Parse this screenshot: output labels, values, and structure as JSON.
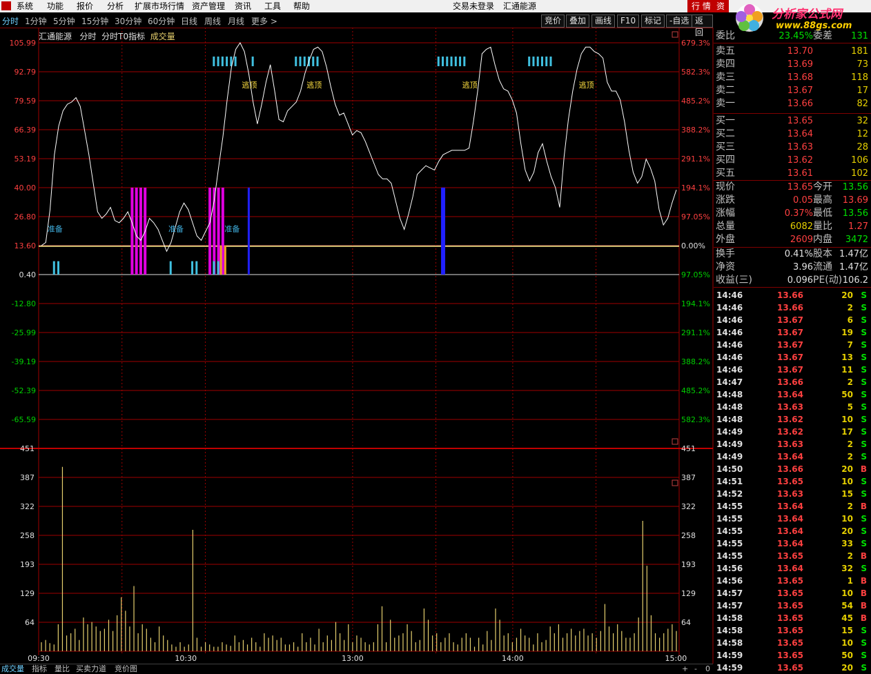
{
  "menubar": {
    "items": [
      "系统",
      "功能",
      "报价",
      "分析",
      "扩展市场行情",
      "资产管理",
      "资讯",
      "工具",
      "帮助"
    ],
    "status": "交易未登录",
    "stock_name": "汇通能源",
    "right_tabs": [
      "行 情",
      "资"
    ]
  },
  "watermark": {
    "title": "分析家公式网",
    "url": "www.88gs.com"
  },
  "periods": {
    "items": [
      "分时",
      "1分钟",
      "5分钟",
      "15分钟",
      "30分钟",
      "60分钟",
      "日线",
      "周线",
      "月线",
      "更多 >"
    ],
    "active": 0
  },
  "toolbar": [
    "竞价",
    "叠加",
    "画线",
    "F10",
    "标记",
    "-自选",
    "返回"
  ],
  "chart_header": {
    "name": "汇通能源",
    "mode": "分时",
    "indicator": "分时T0指标",
    "volume_label": "成交量"
  },
  "chart_data": [
    {
      "type": "line",
      "title": "分时T0指标",
      "ylim": [
        -72.0,
        112.0
      ],
      "y_tick_labels_left": [
        "105.99",
        "92.79",
        "79.59",
        "66.39",
        "53.19",
        "40.00",
        "26.80",
        "13.60",
        "0.40",
        "-12.80",
        "-25.99",
        "-39.19",
        "-52.39",
        "-65.59"
      ],
      "y_tick_labels_right": [
        "679.3%",
        "582.3%",
        "485.2%",
        "388.2%",
        "291.1%",
        "194.1%",
        "97.05%",
        "0.00%",
        "97.05%",
        "194.1%",
        "291.1%",
        "388.2%",
        "485.2%",
        "582.3%"
      ],
      "x_tick_labels": [
        "09:30",
        "10:30",
        "13:00",
        "14:00",
        "15:00"
      ],
      "series": [
        {
          "values": [
            13.6,
            15,
            30,
            55,
            68,
            75,
            78,
            79,
            81,
            77,
            66,
            55,
            42,
            29,
            26,
            28,
            31,
            25,
            24,
            26,
            29,
            24,
            18,
            16,
            20,
            26,
            24,
            21,
            16,
            11,
            15,
            22,
            29,
            33,
            30,
            24,
            18,
            16,
            20,
            24,
            34,
            49,
            63,
            80,
            95,
            103,
            106,
            102,
            92,
            79,
            69,
            78,
            88,
            96,
            84,
            71,
            70,
            75,
            77,
            79,
            84,
            92,
            98,
            103,
            104,
            102,
            95,
            86,
            78,
            73,
            74,
            69,
            64,
            66,
            65,
            61,
            56,
            51,
            46,
            44,
            44,
            42,
            34,
            26,
            21,
            28,
            36,
            46,
            48,
            50,
            49,
            48,
            52,
            55,
            56,
            57,
            57,
            57,
            57,
            58,
            70,
            84,
            101,
            103,
            104,
            96,
            89,
            85,
            84,
            80,
            74,
            60,
            48,
            43,
            47,
            56,
            60,
            52,
            45,
            40,
            31,
            54,
            71,
            84,
            94,
            101,
            104,
            104,
            102,
            101,
            99,
            88,
            84,
            84,
            80,
            70,
            57,
            47,
            42,
            45,
            53,
            49,
            43,
            30,
            23,
            26,
            33,
            39
          ]
        }
      ],
      "annotations": [
        {
          "text": "准备",
          "x_index": 3
        },
        {
          "text": "准备",
          "x_index": 31
        },
        {
          "text": "准备",
          "x_index": 44
        },
        {
          "text": "逃顶",
          "x_index": 48
        },
        {
          "text": "逃顶",
          "x_index": 63
        },
        {
          "text": "逃顶",
          "x_index": 99
        },
        {
          "text": "逃顶",
          "x_index": 126
        }
      ],
      "magenta_bars": [
        21,
        22,
        23,
        24,
        39,
        40,
        41,
        42
      ],
      "blue_bars": [
        48,
        93
      ],
      "top_markers": [
        40,
        41,
        42,
        43,
        44,
        45,
        49,
        59,
        60,
        61,
        62,
        63,
        64,
        92,
        93,
        94,
        95,
        96,
        97,
        98,
        113,
        114,
        115,
        116,
        117,
        118
      ]
    },
    {
      "type": "bar",
      "title": "成交量",
      "ylim": [
        0,
        470
      ],
      "y_tick_labels": [
        "451",
        "387",
        "322",
        "258",
        "193",
        "129",
        "64"
      ],
      "x_tick_labels": [
        "09:30",
        "10:30",
        "13:00",
        "14:00",
        "15:00"
      ],
      "values": [
        20,
        25,
        18,
        15,
        60,
        410,
        35,
        40,
        50,
        25,
        75,
        60,
        65,
        55,
        45,
        50,
        70,
        45,
        80,
        120,
        90,
        55,
        145,
        40,
        60,
        50,
        30,
        20,
        55,
        35,
        25,
        15,
        10,
        20,
        10,
        15,
        270,
        30,
        10,
        20,
        15,
        10,
        10,
        20,
        15,
        12,
        35,
        20,
        25,
        15,
        30,
        20,
        10,
        40,
        30,
        35,
        25,
        30,
        15,
        15,
        20,
        10,
        40,
        20,
        30,
        15,
        50,
        20,
        35,
        25,
        65,
        40,
        25,
        60,
        20,
        35,
        30,
        20,
        15,
        20,
        60,
        100,
        20,
        70,
        30,
        35,
        40,
        60,
        45,
        20,
        25,
        95,
        70,
        35,
        40,
        20,
        30,
        40,
        20,
        15,
        30,
        40,
        30,
        10,
        30,
        15,
        45,
        25,
        95,
        70,
        35,
        40,
        20,
        30,
        50,
        35,
        30,
        15,
        40,
        20,
        25,
        55,
        40,
        60,
        30,
        40,
        50,
        35,
        45,
        50,
        35,
        40,
        30,
        45,
        105,
        55,
        40,
        60,
        45,
        30,
        30,
        40,
        75,
        290,
        190,
        80,
        40,
        30,
        40,
        50,
        60,
        45
      ]
    }
  ],
  "quote": {
    "weibi": {
      "label": "委比",
      "value": "23.45%",
      "label2": "委差",
      "value2": "131"
    },
    "asks": [
      {
        "label": "卖五",
        "price": "13.70",
        "vol": "181"
      },
      {
        "label": "卖四",
        "price": "13.69",
        "vol": "73"
      },
      {
        "label": "卖三",
        "price": "13.68",
        "vol": "118"
      },
      {
        "label": "卖二",
        "price": "13.67",
        "vol": "17"
      },
      {
        "label": "卖一",
        "price": "13.66",
        "vol": "82"
      }
    ],
    "bids": [
      {
        "label": "买一",
        "price": "13.65",
        "vol": "32"
      },
      {
        "label": "买二",
        "price": "13.64",
        "vol": "12"
      },
      {
        "label": "买三",
        "price": "13.63",
        "vol": "28"
      },
      {
        "label": "买四",
        "price": "13.62",
        "vol": "106"
      },
      {
        "label": "买五",
        "price": "13.61",
        "vol": "102"
      }
    ],
    "stats": [
      {
        "l1": "现价",
        "v1": "13.65",
        "c1": "red",
        "l2": "今开",
        "v2": "13.56",
        "c2": "green"
      },
      {
        "l1": "涨跌",
        "v1": "0.05",
        "c1": "red",
        "l2": "最高",
        "v2": "13.69",
        "c2": "red"
      },
      {
        "l1": "涨幅",
        "v1": "0.37%",
        "c1": "red",
        "l2": "最低",
        "v2": "13.56",
        "c2": "green"
      },
      {
        "l1": "总量",
        "v1": "6082",
        "c1": "yellow",
        "l2": "量比",
        "v2": "1.27",
        "c2": "red"
      },
      {
        "l1": "外盘",
        "v1": "2609",
        "c1": "red",
        "l2": "内盘",
        "v2": "3472",
        "c2": "green"
      }
    ],
    "stats2": [
      {
        "l1": "换手",
        "v1": "0.41%",
        "c1": "white",
        "l2": "股本",
        "v2": "1.47亿",
        "c2": "white"
      },
      {
        "l1": "净资",
        "v1": "3.96",
        "c1": "white",
        "l2": "流通",
        "v2": "1.47亿",
        "c2": "white"
      },
      {
        "l1": "收益(三)",
        "v1": "0.096",
        "c1": "white",
        "l2": "PE(动)",
        "v2": "106.2",
        "c2": "white"
      }
    ]
  },
  "ticks": [
    {
      "t": "14:46",
      "p": "13.66",
      "v": "20",
      "s": "S"
    },
    {
      "t": "14:46",
      "p": "13.66",
      "v": "2",
      "s": "S"
    },
    {
      "t": "14:46",
      "p": "13.67",
      "v": "6",
      "s": "S"
    },
    {
      "t": "14:46",
      "p": "13.67",
      "v": "19",
      "s": "S"
    },
    {
      "t": "14:46",
      "p": "13.67",
      "v": "7",
      "s": "S"
    },
    {
      "t": "14:46",
      "p": "13.67",
      "v": "13",
      "s": "S"
    },
    {
      "t": "14:46",
      "p": "13.67",
      "v": "11",
      "s": "S"
    },
    {
      "t": "14:47",
      "p": "13.66",
      "v": "2",
      "s": "S"
    },
    {
      "t": "14:48",
      "p": "13.64",
      "v": "50",
      "s": "S"
    },
    {
      "t": "14:48",
      "p": "13.63",
      "v": "5",
      "s": "S"
    },
    {
      "t": "14:48",
      "p": "13.62",
      "v": "10",
      "s": "S"
    },
    {
      "t": "14:49",
      "p": "13.62",
      "v": "17",
      "s": "S"
    },
    {
      "t": "14:49",
      "p": "13.63",
      "v": "2",
      "s": "S"
    },
    {
      "t": "14:49",
      "p": "13.64",
      "v": "2",
      "s": "S"
    },
    {
      "t": "14:50",
      "p": "13.66",
      "v": "20",
      "s": "B"
    },
    {
      "t": "14:51",
      "p": "13.65",
      "v": "10",
      "s": "S"
    },
    {
      "t": "14:52",
      "p": "13.63",
      "v": "15",
      "s": "S"
    },
    {
      "t": "14:55",
      "p": "13.64",
      "v": "2",
      "s": "B"
    },
    {
      "t": "14:55",
      "p": "13.64",
      "v": "10",
      "s": "S"
    },
    {
      "t": "14:55",
      "p": "13.64",
      "v": "20",
      "s": "S"
    },
    {
      "t": "14:55",
      "p": "13.64",
      "v": "33",
      "s": "S"
    },
    {
      "t": "14:55",
      "p": "13.65",
      "v": "2",
      "s": "B"
    },
    {
      "t": "14:56",
      "p": "13.64",
      "v": "32",
      "s": "S"
    },
    {
      "t": "14:56",
      "p": "13.65",
      "v": "1",
      "s": "B"
    },
    {
      "t": "14:57",
      "p": "13.65",
      "v": "10",
      "s": "B"
    },
    {
      "t": "14:57",
      "p": "13.65",
      "v": "54",
      "s": "B"
    },
    {
      "t": "14:58",
      "p": "13.65",
      "v": "45",
      "s": "B"
    },
    {
      "t": "14:58",
      "p": "13.65",
      "v": "15",
      "s": "S"
    },
    {
      "t": "14:58",
      "p": "13.65",
      "v": "10",
      "s": "S"
    },
    {
      "t": "14:59",
      "p": "13.65",
      "v": "50",
      "s": "S"
    },
    {
      "t": "14:59",
      "p": "13.65",
      "v": "20",
      "s": "S"
    }
  ],
  "bottom_tabs": [
    "成交量",
    "指标",
    "量比",
    "买卖力道",
    "竞价图"
  ],
  "bottom_right": [
    "+",
    "-",
    "0"
  ],
  "colors": {
    "line": "#ffffff",
    "grid": "#a00000",
    "magenta": "#e000e0",
    "blue": "#2020ff",
    "cyan": "#40c0e0",
    "volume": "#e6d06e"
  }
}
